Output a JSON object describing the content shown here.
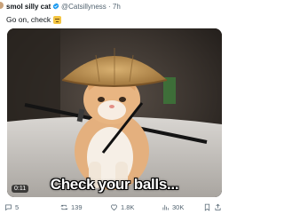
{
  "tweet": {
    "display_name": "smol silly cat",
    "handle_time": "@Catsillyness · 7h",
    "text": "Go on, check",
    "text_emoji": "face-with-raised-eyebrow-emoji"
  },
  "media": {
    "duration": "0:11",
    "caption": "Check your balls..."
  },
  "actions": {
    "reply_count": "5",
    "retweet_count": "139",
    "like_count": "1.8K",
    "views_count": "30K"
  },
  "icons": {
    "verified": "verified-badge-icon",
    "reply": "reply-icon",
    "retweet": "retweet-icon",
    "like": "heart-icon",
    "views": "views-icon",
    "bookmark": "bookmark-icon",
    "share": "share-icon"
  },
  "colors": {
    "verified": "#1d9bf0",
    "muted": "#536471",
    "text": "#0f1419"
  }
}
